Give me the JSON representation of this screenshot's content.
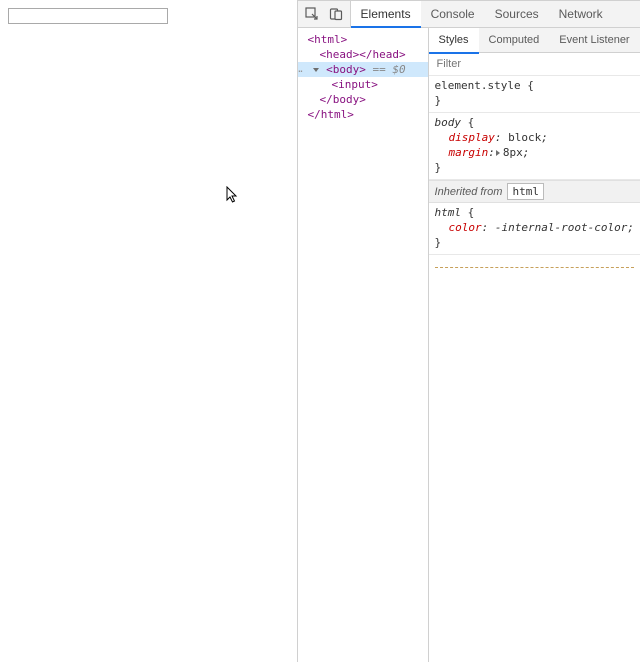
{
  "devtools": {
    "main_tabs": {
      "elements": "Elements",
      "console": "Console",
      "sources": "Sources",
      "network": "Network"
    },
    "active_main_tab": "elements",
    "side_tabs": {
      "styles": "Styles",
      "computed": "Computed",
      "event_listeners": "Event Listener"
    },
    "active_side_tab": "styles",
    "filter_placeholder": "Filter",
    "dom": {
      "l0": "<html>",
      "l1": "<head></head>",
      "l2_open": "<body>",
      "l2_suffix": " == $0",
      "l3": "<input>",
      "l4": "</body>",
      "l5": "</html>",
      "gutter_dots": "…"
    },
    "styles": {
      "element_style": {
        "selector": "element.style",
        "open": " {",
        "close": "}"
      },
      "body_rule": {
        "selector": "body",
        "open": " {",
        "display_name": "display",
        "display_value": "block",
        "margin_name": "margin",
        "margin_value": "8px",
        "close": "}"
      },
      "inherited": {
        "label": "Inherited from ",
        "tag": "html"
      },
      "html_rule": {
        "selector": "html",
        "open": " {",
        "color_name": "color",
        "color_value": "-internal-root-color",
        "close": "}"
      }
    }
  }
}
